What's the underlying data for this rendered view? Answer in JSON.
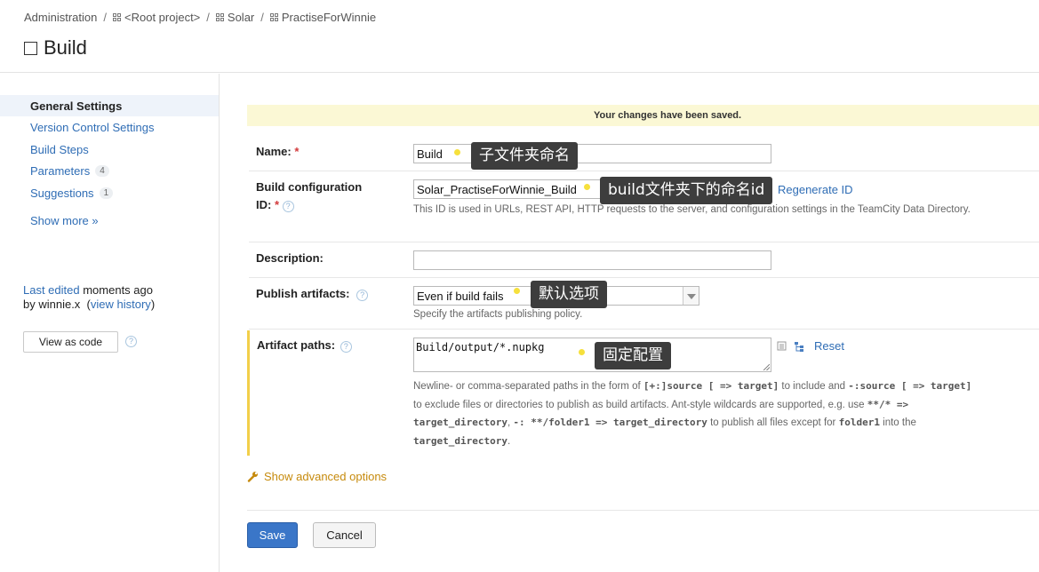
{
  "breadcrumb": [
    "Administration",
    "<Root project>",
    "Solar",
    "PractiseForWinnie"
  ],
  "page_title": "Build",
  "sidebar": {
    "items": [
      {
        "label": "General Settings",
        "active": true
      },
      {
        "label": "Version Control Settings"
      },
      {
        "label": "Build Steps"
      },
      {
        "label": "Parameters",
        "count": "4"
      },
      {
        "label": "Suggestions",
        "count": "1"
      }
    ],
    "show_more": "Show more »",
    "last_edited_link": "Last edited",
    "last_edited_time": " moments ago",
    "last_edited_by": "by winnie.x",
    "view_history": "view history",
    "view_as_code": "View as code"
  },
  "banner": "Your changes have been saved.",
  "form": {
    "name_label": "Name:",
    "name_value": "Build",
    "id_label_1": "Build configuration",
    "id_label_2": "ID:",
    "id_value": "Solar_PractiseForWinnie_Build",
    "regenerate_id": "Regenerate ID",
    "id_hint": "This ID is used in URLs, REST API, HTTP requests to the server, and configuration settings in the TeamCity Data Directory.",
    "description_label": "Description:",
    "description_value": "",
    "publish_label": "Publish artifacts:",
    "publish_value": "Even if build fails",
    "publish_hint": "Specify the artifacts publishing policy.",
    "artifact_label": "Artifact paths:",
    "artifact_value": "Build/output/*.nupkg",
    "reset": "Reset",
    "artifact_hint": {
      "t1": "Newline- or comma-separated paths in the form of ",
      "c1": "[+:]source [ => target]",
      "t2": " to include and",
      "c2": "-:source [ => target]",
      "t3": " to exclude files or directories to publish as build artifacts. Ant-style wildcards are supported, e.g. use ",
      "c3": "**/* => target_directory",
      "t4": ", ",
      "c4": "-: **/folder1 => target_directory",
      "t5": " to publish all files except for ",
      "c5": "folder1",
      "t6": " into the ",
      "c6": "target_directory",
      "t7": "."
    },
    "show_advanced": "Show advanced options",
    "save": "Save",
    "cancel": "Cancel"
  },
  "annotations": {
    "name_note": "子文件夹命名",
    "id_note": "build文件夹下的命名id",
    "publish_note": "默认选项",
    "artifact_note": "固定配置"
  },
  "colors": {
    "link": "#2f6db5",
    "banner": "#fbf8d5",
    "accent_bar": "#f2cf4a",
    "save": "#3a76c8",
    "advanced": "#c68a0c",
    "note_bg": "#3d3d3d",
    "dot": "#f6e03c"
  }
}
